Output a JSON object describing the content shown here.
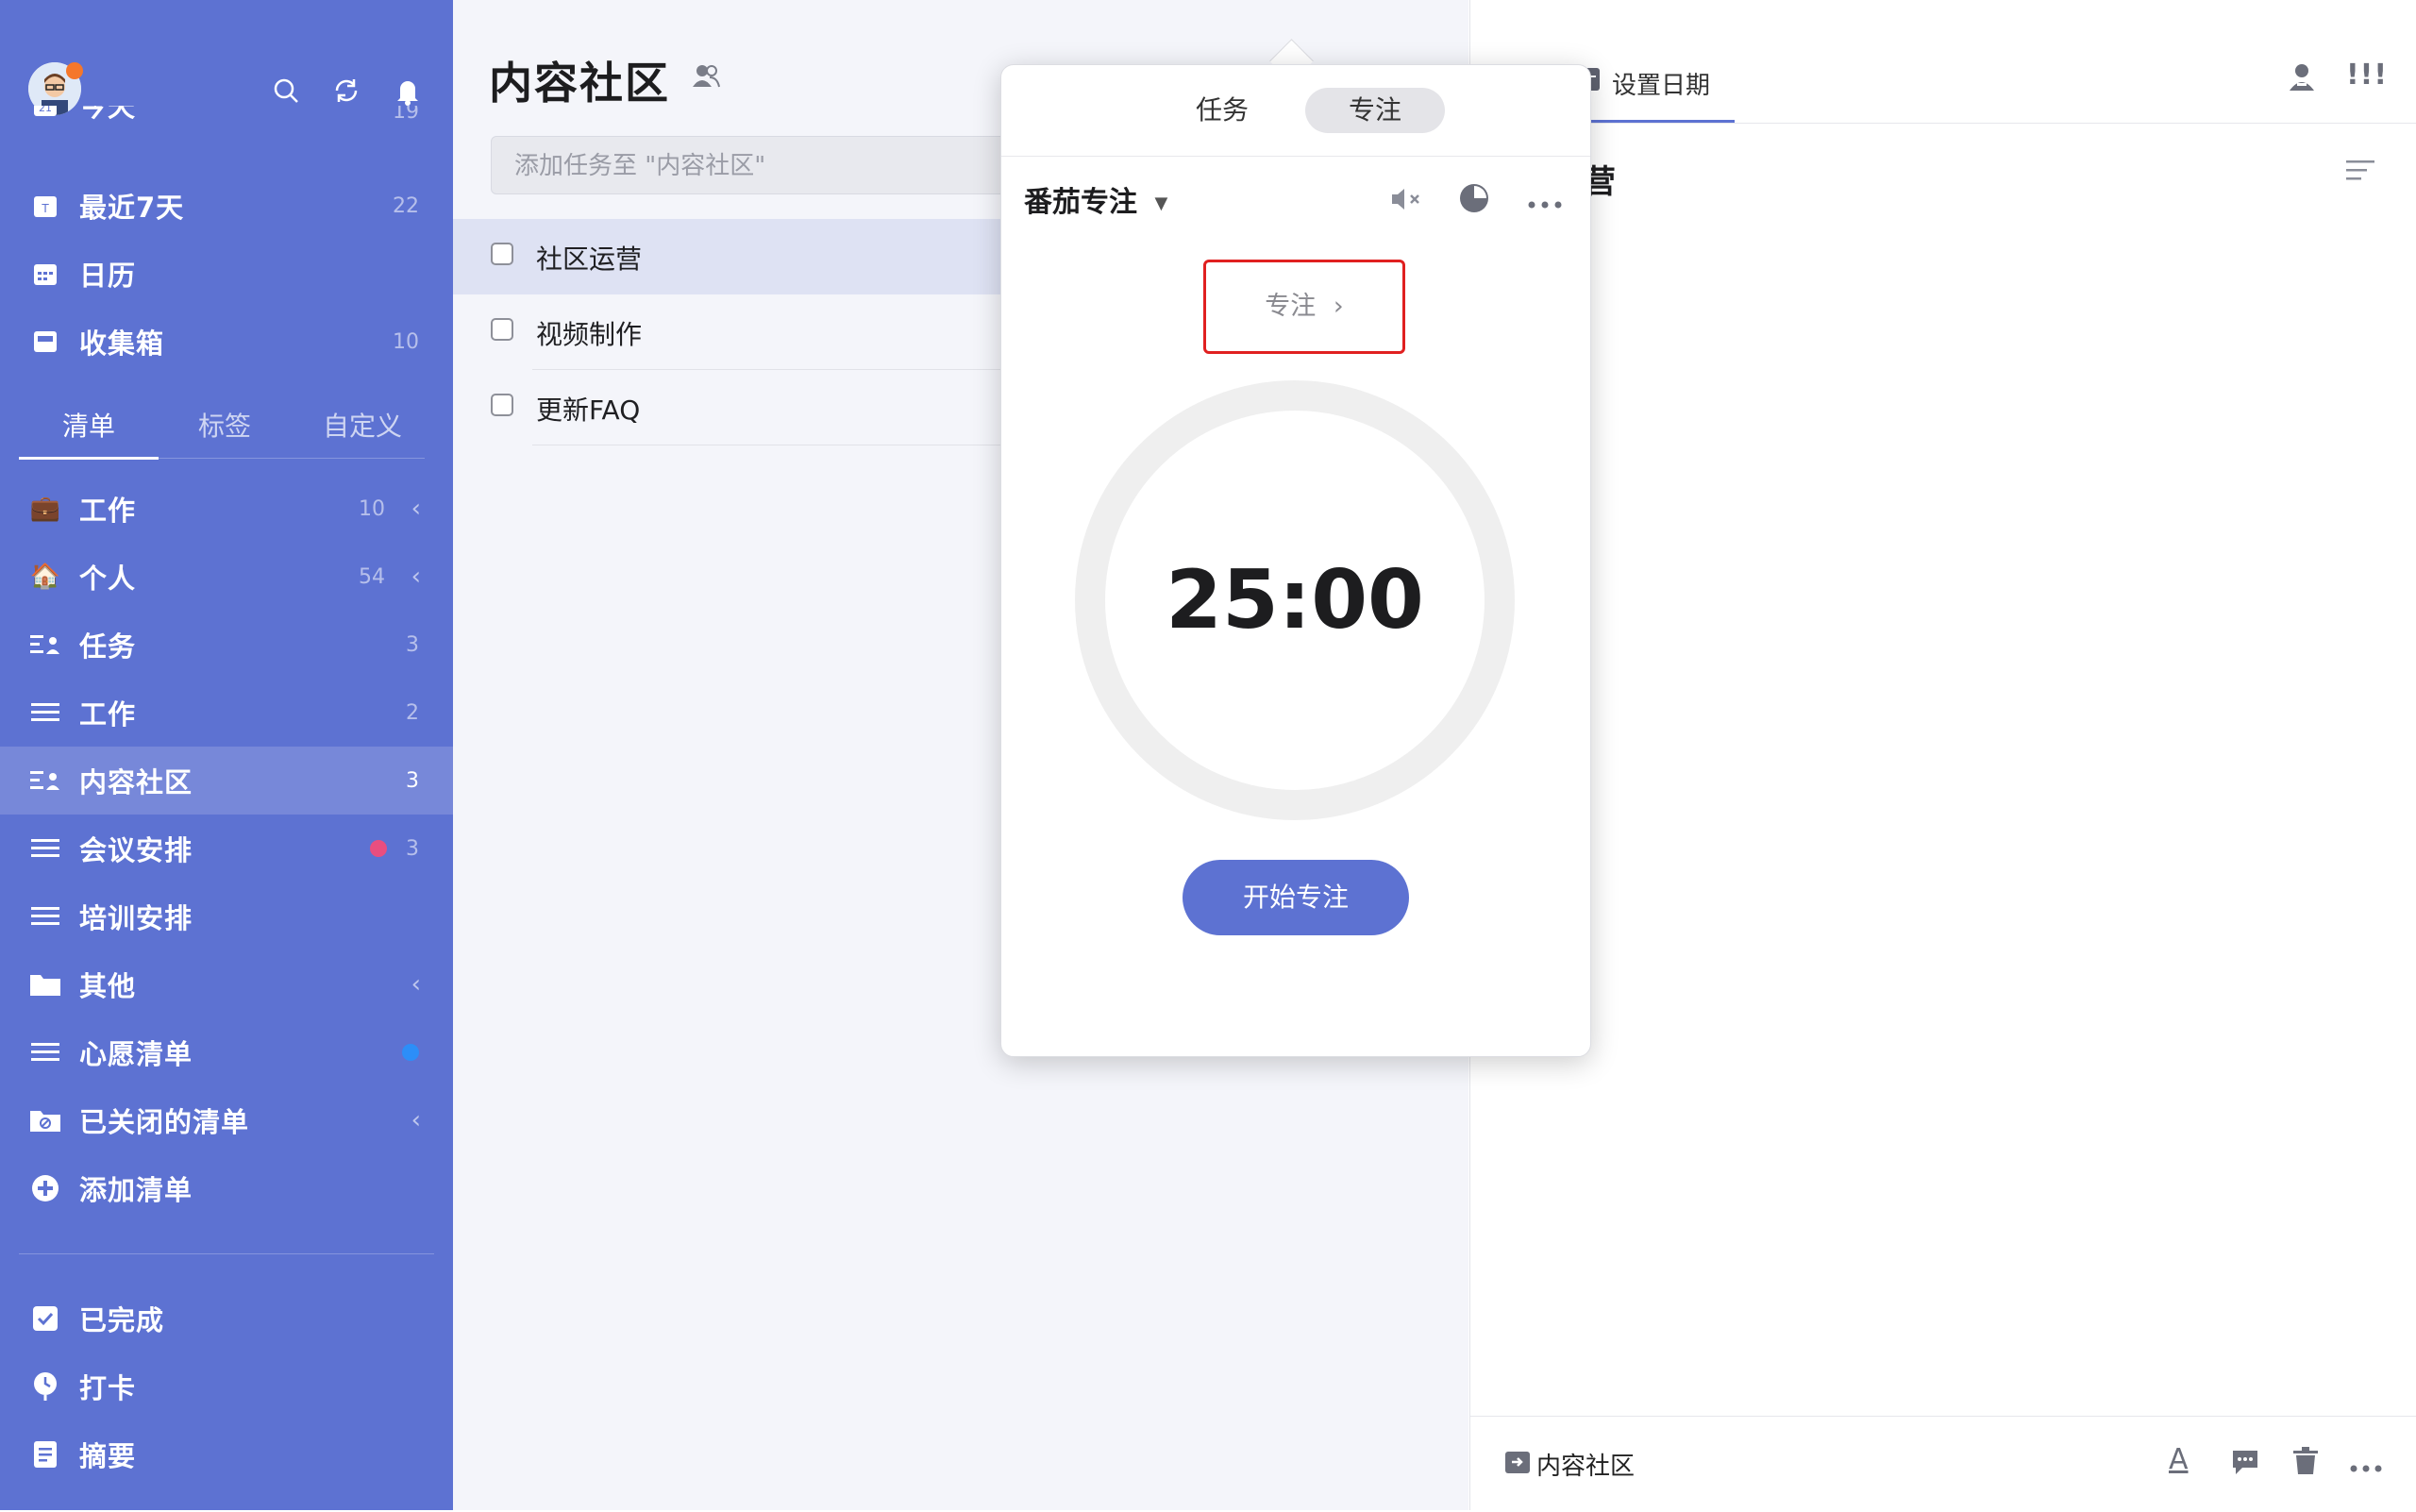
{
  "sidebar": {
    "header_icons": [
      "avatar",
      "search-icon",
      "refresh-icon",
      "bell-icon"
    ],
    "smart_lists": [
      {
        "label": "今天",
        "count": "19",
        "icon": "today-icon"
      },
      {
        "label": "最近7天",
        "count": "22",
        "icon": "next7days-icon"
      },
      {
        "label": "日历",
        "count": "",
        "icon": "calendar-icon"
      },
      {
        "label": "收集箱",
        "count": "10",
        "icon": "inbox-icon"
      }
    ],
    "tabs": [
      "清单",
      "标签",
      "自定义"
    ],
    "lists": [
      {
        "label": "工作",
        "count": "10",
        "icon": "briefcase-emoji",
        "glyph": "💼",
        "chevron": true
      },
      {
        "label": "个人",
        "count": "54",
        "icon": "house-emoji",
        "glyph": "🏠",
        "chevron": true
      },
      {
        "label": "任务",
        "count": "3",
        "icon": "shared-list-icon"
      },
      {
        "label": "工作",
        "count": "2",
        "icon": "list-icon"
      },
      {
        "label": "内容社区",
        "count": "3",
        "icon": "shared-list-icon",
        "active": true
      },
      {
        "label": "会议安排",
        "count": "3",
        "icon": "list-icon",
        "dot": "#e94e7f"
      },
      {
        "label": "培训安排",
        "count": "",
        "icon": "list-icon"
      },
      {
        "label": "其他",
        "count": "",
        "icon": "folder-icon",
        "chevron": true
      },
      {
        "label": "心愿清单",
        "count": "",
        "icon": "list-icon",
        "dot": "#2c8ef8"
      },
      {
        "label": "已关闭的清单",
        "count": "",
        "icon": "archive-folder-icon",
        "chevron": true
      },
      {
        "label": "添加清单",
        "count": "",
        "icon": "add-circle-icon"
      }
    ],
    "bottom": [
      {
        "label": "已完成",
        "icon": "checkbox-icon"
      },
      {
        "label": "打卡",
        "icon": "habit-icon"
      },
      {
        "label": "摘要",
        "icon": "summary-icon"
      }
    ]
  },
  "list_panel": {
    "title": "内容社区",
    "add_placeholder": "添加任务至 \"内容社区\"",
    "tasks": [
      "社区运营",
      "视频制作",
      "更新FAQ"
    ]
  },
  "detail": {
    "date_label": "设置日期",
    "title_visible": "营",
    "list_name": "内容社区"
  },
  "focus_popup": {
    "tabs": [
      "任务",
      "专注"
    ],
    "active_tab": "专注",
    "mode": "番茄专注",
    "focus_link": "专注",
    "timer": "25:00",
    "start_button": "开始专注"
  },
  "colors": {
    "sidebar_bg": "#5d72d2",
    "accent": "#5d72d2",
    "highlight_box": "#e02020"
  }
}
